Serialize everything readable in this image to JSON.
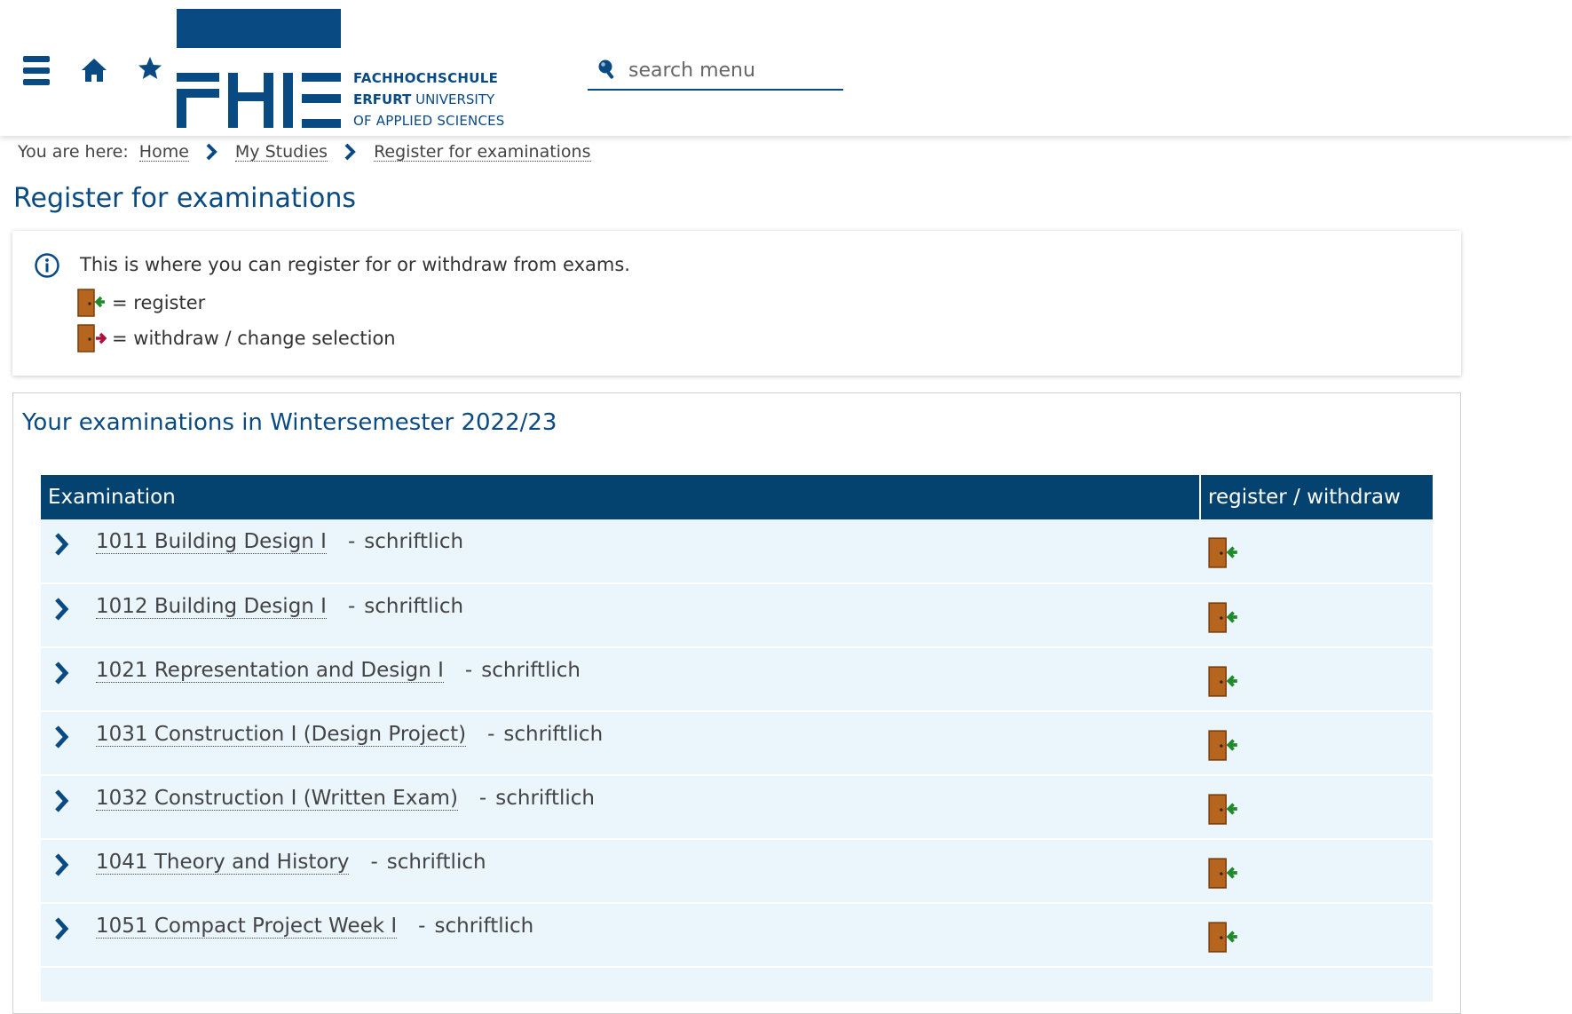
{
  "header": {
    "menu_icon": "hamburger-menu-icon",
    "home_icon": "home-icon",
    "favorites_icon": "star-icon",
    "logo": {
      "line1": "FACHHOCHSCHULE",
      "line2_bold": "ERFURT",
      "line2_rest": " UNIVERSITY",
      "line3": "OF APPLIED SCIENCES",
      "brand_color": "#0a4a82"
    },
    "search": {
      "placeholder": "search menu",
      "value": ""
    }
  },
  "breadcrumb": {
    "label": "You are here:",
    "items": [
      "Home",
      "My Studies",
      "Register for examinations"
    ]
  },
  "page_title": "Register for examinations",
  "info": {
    "text": "This is where you can register for or withdraw from exams.",
    "legend_register": "= register",
    "legend_withdraw": "= withdraw / change selection"
  },
  "exams": {
    "title": "Your examinations in Wintersemester 2022/23",
    "columns": [
      "Examination",
      "register / withdraw"
    ],
    "separator": "-",
    "rows": [
      {
        "name": "1011 Building Design I",
        "type": "schriftlich"
      },
      {
        "name": "1012 Building Design I",
        "type": "schriftlich"
      },
      {
        "name": "1021 Representation and Design I",
        "type": "schriftlich"
      },
      {
        "name": "1031 Construction I (Design Project)",
        "type": "schriftlich"
      },
      {
        "name": "1032 Construction I (Written Exam)",
        "type": "schriftlich"
      },
      {
        "name": "1041 Theory and History",
        "type": "schriftlich"
      },
      {
        "name": "1051 Compact Project Week I",
        "type": "schriftlich"
      }
    ]
  },
  "colors": {
    "table_header": "#04426f",
    "row_background": "#eaf5fc",
    "register_arrow": "#1f8a2a",
    "withdraw_arrow": "#b0103c",
    "door": "#b5651d"
  }
}
